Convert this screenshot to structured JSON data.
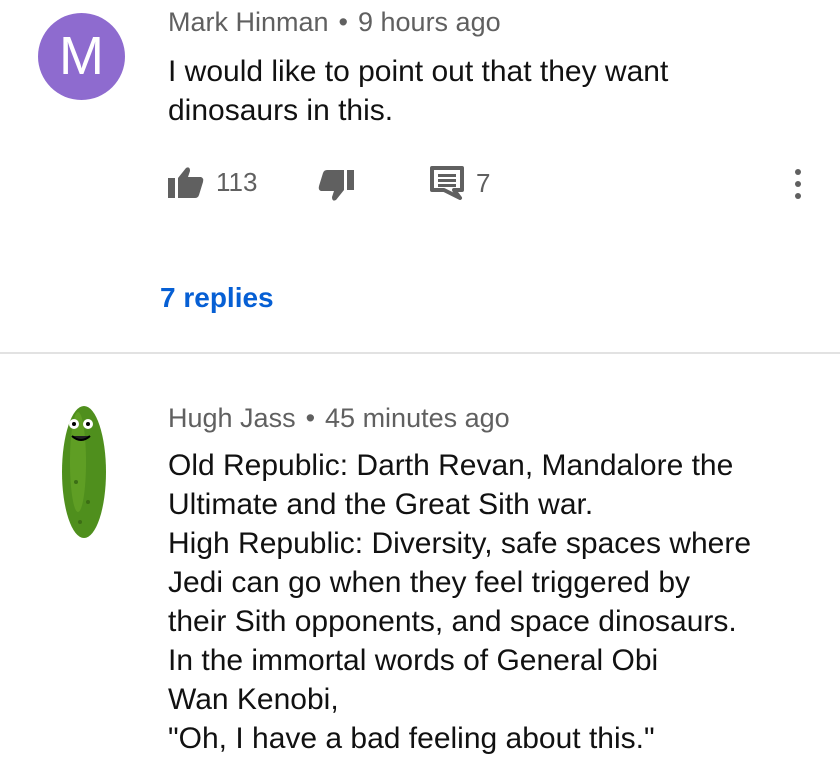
{
  "comments": [
    {
      "author": "Mark Hinman",
      "time": "9 hours ago",
      "avatar_letter": "M",
      "avatar_color": "#8e6bcf",
      "text_lines": [
        "I would like to point out that they want",
        "dinosaurs in this."
      ],
      "likes": "113",
      "reply_count": "7",
      "replies_link": "7 replies"
    },
    {
      "author": "Hugh Jass",
      "time": "45 minutes ago",
      "avatar_icon": "pickle-avatar",
      "text_lines": [
        "Old Republic: Darth Revan, Mandalore the",
        "Ultimate and the Great Sith war.",
        "High Republic: Diversity, safe spaces where",
        "Jedi can go when they feel triggered by",
        "their Sith opponents, and space dinosaurs.",
        "In the immortal words of General Obi",
        "Wan Kenobi,",
        "\"Oh, I have a bad feeling about this.\""
      ]
    }
  ],
  "colors": {
    "link_blue": "#065fd4",
    "meta_gray": "#606060",
    "divider": "#e2e2e2"
  },
  "separator": "•"
}
